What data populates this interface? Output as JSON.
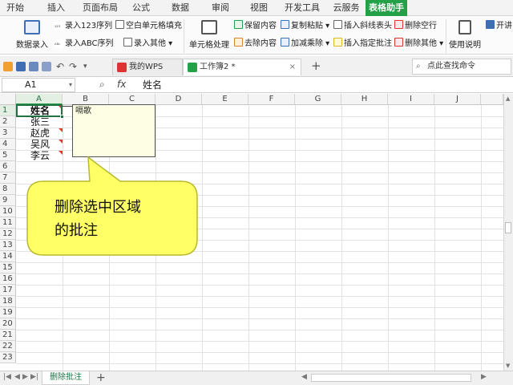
{
  "ribbon_tabs": [
    "开始",
    "插入",
    "页面布局",
    "公式",
    "数据",
    "审阅",
    "视图",
    "开发工具",
    "云服务",
    "表格助手"
  ],
  "ribbon": {
    "data_entry": "数据录入",
    "enter_123": "录入123序列",
    "enter_abc": "录入ABC序列",
    "blank_fill": "空白单元格填充",
    "enter_other": "录入其他",
    "cell_processing": "单元格处理",
    "keep_content": "保留内容",
    "remove_content": "去除内容",
    "copy_paste": "复制粘贴",
    "add_sub_mul_div": "加减乘除",
    "insert_diag_header": "插入斜线表头",
    "insert_comment": "插入指定批注",
    "delete_blank_rows": "删除空行",
    "delete_other": "删除其他",
    "usage_guide": "使用说明",
    "open": "开讲"
  },
  "docbar": {
    "my_wps": "我的WPS",
    "workbook": "工作簿2 *",
    "close": "×",
    "add_tab": "+",
    "find_command": "点此查找命令"
  },
  "formula_bar": {
    "cell_ref": "A1",
    "fx": "fx",
    "value": "姓名"
  },
  "columns": [
    "A",
    "B",
    "C",
    "D",
    "E",
    "F",
    "G",
    "H",
    "I",
    "J"
  ],
  "rows": [
    "1",
    "2",
    "3",
    "4",
    "5",
    "6",
    "7",
    "8",
    "9",
    "10",
    "11",
    "12",
    "13",
    "14",
    "15",
    "16",
    "17",
    "18",
    "19",
    "20",
    "21",
    "22",
    "23"
  ],
  "cells": [
    "姓名",
    "张三",
    "赵虎",
    "吴风",
    "李云"
  ],
  "comment_text": "嗝歌",
  "callout": [
    "删除选中区域",
    "的批注"
  ],
  "sheet_tab": "删除批注",
  "add_sheet": "+",
  "colors": {
    "accent": "#24a148",
    "comment_fill": "#fefee4",
    "callout_fill": "#ffff66"
  }
}
